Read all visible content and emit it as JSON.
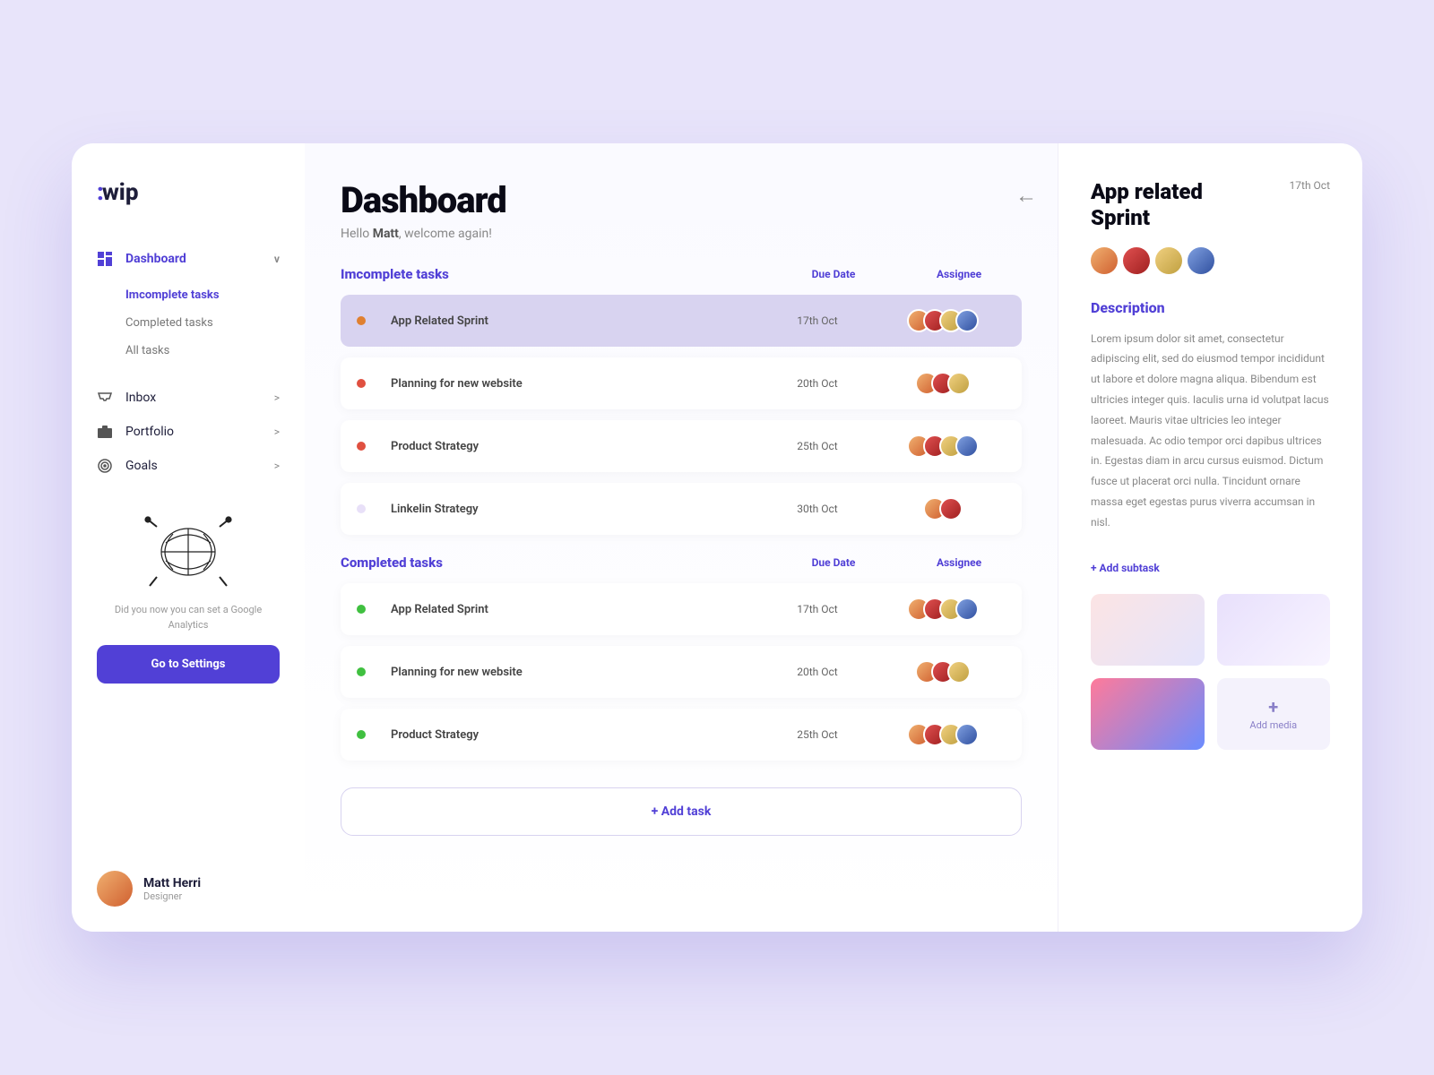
{
  "logo": "wip",
  "sidebar": {
    "items": [
      {
        "icon": "grid",
        "label": "Dashboard",
        "active": true,
        "expand": "v"
      },
      {
        "icon": "inbox",
        "label": "Inbox",
        "expand": ">"
      },
      {
        "icon": "briefcase",
        "label": "Portfolio",
        "expand": ">"
      },
      {
        "icon": "target",
        "label": "Goals",
        "expand": ">"
      }
    ],
    "subnav": [
      {
        "label": "Imcomplete tasks",
        "active": true
      },
      {
        "label": "Completed tasks"
      },
      {
        "label": "All tasks"
      }
    ],
    "promo": {
      "text": "Did you now you can set a Google Analytics",
      "button": "Go to Settings"
    },
    "user": {
      "name": "Matt Herri",
      "role": "Designer"
    }
  },
  "main": {
    "title": "Dashboard",
    "greeting_pre": "Hello ",
    "greeting_name": "Matt",
    "greeting_post": ", welcome again!",
    "col_due": "Due Date",
    "col_assignee": "Assignee",
    "incomplete": {
      "title": "Imcomplete tasks",
      "rows": [
        {
          "dot": "#e08030",
          "name": "App Related Sprint",
          "due": "17th Oct",
          "avs": 4,
          "sel": true
        },
        {
          "dot": "#e05040",
          "name": "Planning for new website",
          "due": "20th Oct",
          "avs": 3
        },
        {
          "dot": "#e05040",
          "name": "Product Strategy",
          "due": "25th Oct",
          "avs": 4
        },
        {
          "dot": "#e8e0f8",
          "name": "Linkelin Strategy",
          "due": "30th Oct",
          "avs": 2
        }
      ]
    },
    "completed": {
      "title": "Completed tasks",
      "rows": [
        {
          "dot": "#40c040",
          "name": "App Related Sprint",
          "due": "17th Oct",
          "avs": 4
        },
        {
          "dot": "#40c040",
          "name": "Planning for new website",
          "due": "20th Oct",
          "avs": 3
        },
        {
          "dot": "#40c040",
          "name": "Product Strategy",
          "due": "25th Oct",
          "avs": 4
        }
      ]
    },
    "add_task": "+ Add task"
  },
  "detail": {
    "title": "App related Sprint",
    "date": "17th Oct",
    "desc_label": "Description",
    "desc_body": "Lorem ipsum dolor sit amet, consectetur adipiscing elit, sed do eiusmod tempor incididunt ut labore et dolore magna aliqua. Bibendum est ultricies integer quis. Iaculis urna id volutpat lacus laoreet. Mauris vitae ultricies leo integer malesuada. Ac odio tempor orci dapibus ultrices in. Egestas diam in arcu cursus euismod. Dictum fusce ut placerat orci nulla. Tincidunt ornare massa eget egestas purus viverra accumsan in nisl.",
    "add_subtask": "+ Add subtask",
    "add_media": "Add media"
  }
}
